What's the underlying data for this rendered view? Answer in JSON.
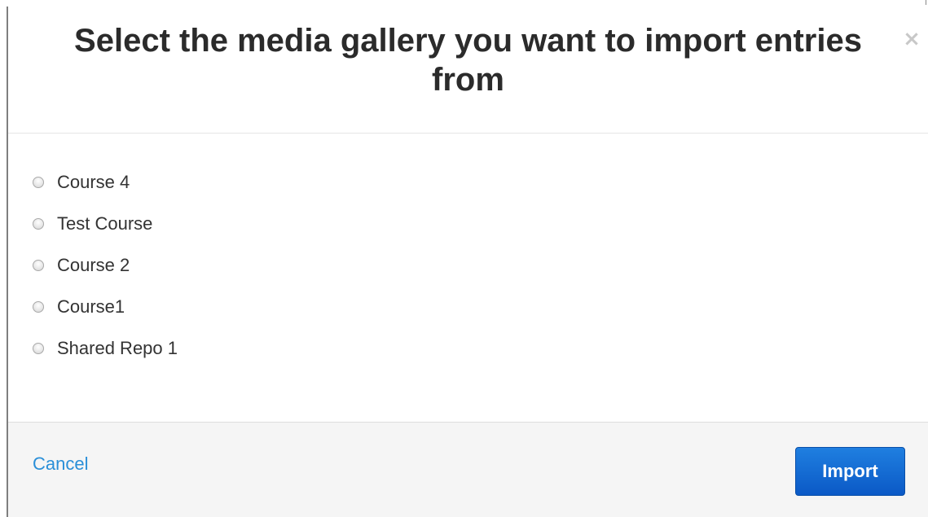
{
  "dialog": {
    "title": "Select the media gallery you want to import entries from",
    "close_symbol": "×",
    "options": [
      {
        "label": "Course 4",
        "selected": false
      },
      {
        "label": "Test Course",
        "selected": false
      },
      {
        "label": "Course 2",
        "selected": false
      },
      {
        "label": "Course1",
        "selected": false
      },
      {
        "label": "Shared Repo 1",
        "selected": false
      }
    ],
    "cancel_label": "Cancel",
    "import_label": "Import"
  },
  "colors": {
    "title_text": "#2b2b2b",
    "link": "#2a8fd8",
    "primary_button": "#0b59c6",
    "footer_bg": "#f5f5f5"
  },
  "icons": {
    "close": "close-icon"
  }
}
